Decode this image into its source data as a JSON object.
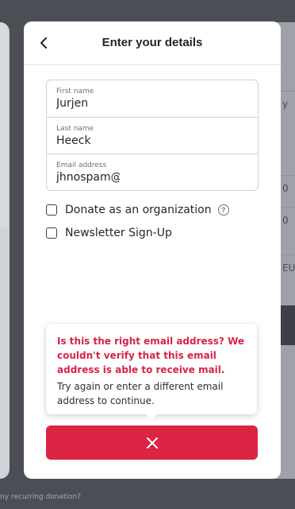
{
  "background": {
    "right_rows": [
      "y",
      "0",
      "0",
      "EUR"
    ],
    "footer_text": "ny recurring donation?"
  },
  "modal": {
    "title": "Enter your details",
    "back_icon": "chevron-left-icon"
  },
  "form": {
    "first_name": {
      "label": "First name",
      "value": "Jurjen"
    },
    "last_name": {
      "label": "Last name",
      "value": "Heeck"
    },
    "email": {
      "label": "Email address",
      "value": "jhnospam@"
    }
  },
  "options": {
    "organization_label": "Donate as an organization",
    "organization_help_icon": "question-circle-icon",
    "newsletter_label": "Newsletter Sign-Up"
  },
  "tooltip": {
    "error_text": "Is this the right email address? We couldn't verify that this email address is able to receive mail.",
    "hint_text": "Try again or enter a different email address to continue."
  },
  "action": {
    "icon": "close-icon"
  },
  "colors": {
    "accent": "#dc2445",
    "error_text": "#d42547"
  }
}
